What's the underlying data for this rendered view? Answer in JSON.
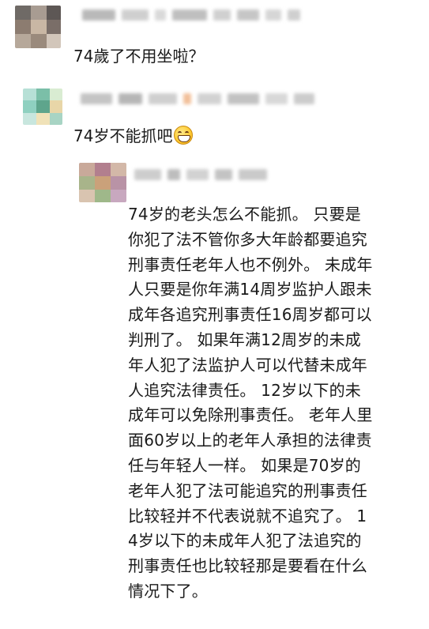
{
  "comments": [
    {
      "text": "74歲了不用坐啦？"
    },
    {
      "text": "74岁不能抓吧",
      "emoji": "grinning-face-emoji"
    }
  ],
  "reply": {
    "lines": [
      "74岁的老头怎么不能抓。 只要是",
      "你犯了法不管你多大年龄都要追究",
      "刑事责任老年人也不例外。 未成年",
      "人只要是你年满14周岁监护人跟未",
      "成年各追究刑事责任16周岁都可以",
      "判刑了。 如果年满12周岁的未成",
      "年人犯了法监护人可以代替未成年",
      "人追究法律责任。 12岁以下的未",
      "成年可以免除刑事责任。 老年人里",
      "面60岁以上的老年人承担的法律责",
      "任与年轻人一样。 如果是70岁的",
      "老年人犯了法可能追究的刑事责任",
      "比较轻并不代表说就不追究了。 1",
      "4岁以下的未成年人犯了法追究的",
      "刑事责任也比较轻那是要看在什么",
      "情况下了。"
    ]
  },
  "colors": {
    "text": "#1a1a1a",
    "blur_name": "#c8c8c8"
  }
}
